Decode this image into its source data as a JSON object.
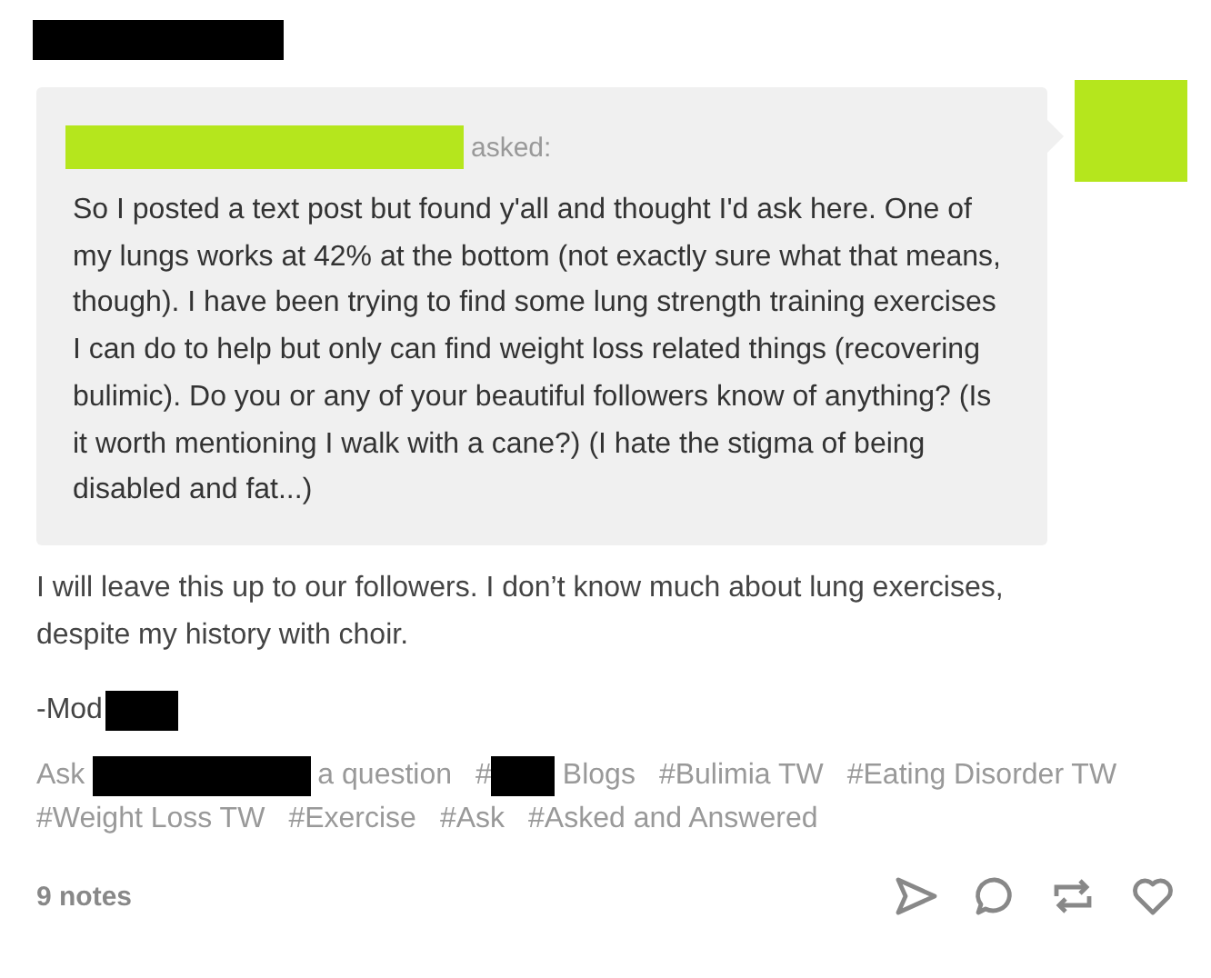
{
  "ask": {
    "asked_label": "asked:",
    "question": "So I posted a text post but found y'all and thought I'd ask here. One of my lungs works at 42% at the bottom (not exactly sure what that means, though). I have been trying to find some lung strength training exercises I can do to help but only can find weight loss related things (recovering bulimic). Do you or any of your beautiful followers know of anything? (Is it worth mentioning I walk with a cane?) (I hate the stigma of being disabled and fat...)"
  },
  "answer": "I will leave this up to our followers. I don’t know much about lung exercises, despite my history with choir.",
  "signature": "-Mod",
  "tags": [
    {
      "kind": "redacted",
      "before": "Ask",
      "after": "a question"
    },
    {
      "kind": "redacted",
      "before": "#",
      "after": "Blogs"
    },
    {
      "kind": "plain",
      "text": "#Bulimia TW"
    },
    {
      "kind": "plain",
      "text": "#Eating Disorder TW"
    },
    {
      "kind": "plain",
      "text": "#Weight Loss TW"
    },
    {
      "kind": "plain",
      "text": "#Exercise"
    },
    {
      "kind": "plain",
      "text": "#Ask"
    },
    {
      "kind": "plain",
      "text": "#Asked and Answered"
    }
  ],
  "notes": "9 notes"
}
